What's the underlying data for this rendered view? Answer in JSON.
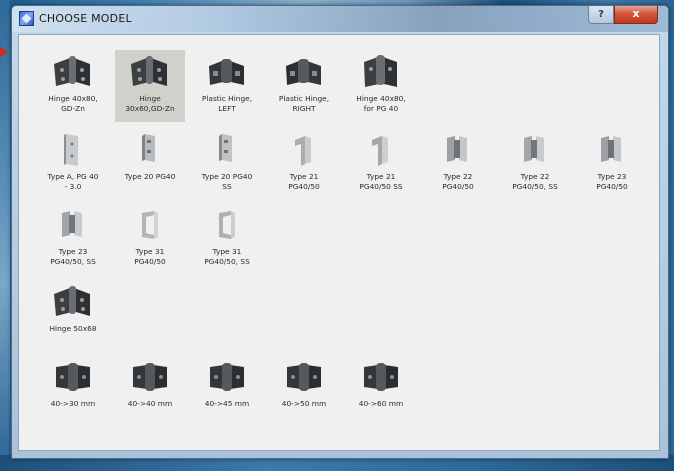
{
  "window": {
    "title": "CHOOSE MODEL",
    "help_glyph": "?",
    "close_glyph": "x"
  },
  "models": [
    {
      "label": "Hinge 40x80,\nGD-Zn",
      "icon": "hinge-dark-icon",
      "selected": false
    },
    {
      "label": "Hinge\n30x60,GD-Zn",
      "icon": "hinge-dark-icon",
      "selected": true
    },
    {
      "label": "Plastic Hinge,\nLEFT",
      "icon": "plastic-hinge-icon",
      "selected": false
    },
    {
      "label": "Plastic Hinge,\nRIGHT",
      "icon": "plastic-hinge-icon",
      "selected": false
    },
    {
      "label": "Hinge 40x80,\nfor PG 40",
      "icon": "hinge-dark-icon",
      "selected": false
    },
    {
      "label": "Type A, PG 40\n- 3.0",
      "icon": "metal-hinge-flat-icon",
      "selected": false
    },
    {
      "label": "Type 20 PG40",
      "icon": "metal-hinge-flat-icon",
      "selected": false
    },
    {
      "label": "Type 20 PG40\nSS",
      "icon": "metal-hinge-flat-icon",
      "selected": false
    },
    {
      "label": "Type 21\nPG40/50",
      "icon": "metal-hinge-bent-icon",
      "selected": false
    },
    {
      "label": "Type 21\nPG40/50 SS",
      "icon": "metal-hinge-bent-icon",
      "selected": false
    },
    {
      "label": "Type 22\nPG40/50",
      "icon": "metal-hinge-double-icon",
      "selected": false
    },
    {
      "label": "Type 22\nPG40/50, SS",
      "icon": "metal-hinge-double-icon",
      "selected": false
    },
    {
      "label": "Type 23\nPG40/50",
      "icon": "metal-hinge-double-icon",
      "selected": false
    },
    {
      "label": "Type 23\nPG40/50, SS",
      "icon": "metal-hinge-double-icon",
      "selected": false
    },
    {
      "label": "Type 31\nPG40/50",
      "icon": "metal-hinge-bent-icon",
      "selected": false
    },
    {
      "label": "Type 31\nPG40/50, SS",
      "icon": "metal-hinge-bent-icon",
      "selected": false
    },
    {
      "label": "Hinge 50x68",
      "icon": "hinge-dark-icon",
      "selected": false
    },
    {
      "label": "40->30 mm",
      "icon": "hinge-block-icon",
      "selected": false
    },
    {
      "label": "40->40 mm",
      "icon": "hinge-block-icon",
      "selected": false
    },
    {
      "label": "40->45 mm",
      "icon": "hinge-block-icon",
      "selected": false
    },
    {
      "label": "40->50 mm",
      "icon": "hinge-block-icon",
      "selected": false
    },
    {
      "label": "40->60 mm",
      "icon": "hinge-block-icon",
      "selected": false
    }
  ],
  "colors": {
    "selection": "#d2d0cb",
    "panel": "#f0f0f0",
    "dark_metal": "#3a3d40",
    "light_metal": "#b9bcbf"
  }
}
